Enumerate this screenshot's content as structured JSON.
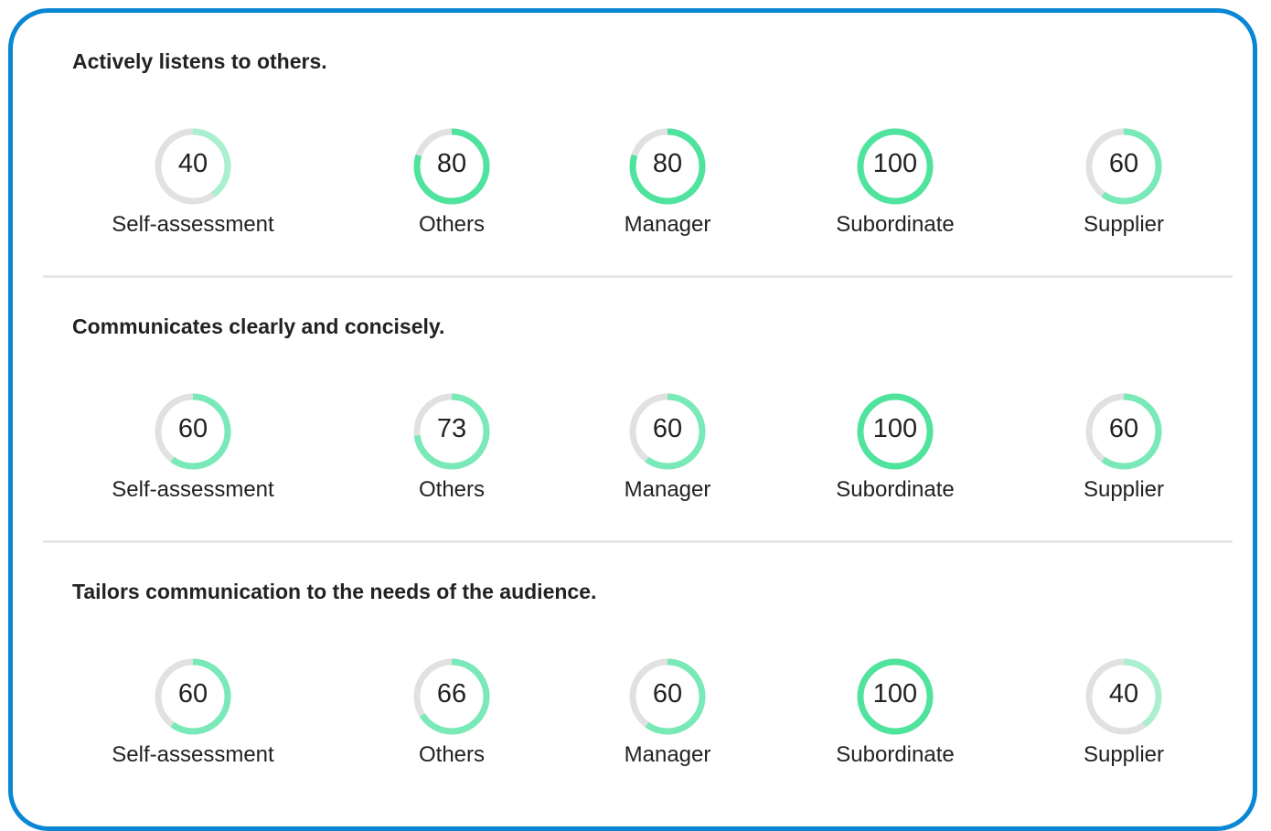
{
  "colors": {
    "border": "#0a87d4",
    "track": "#e1e1e1",
    "high": "#4fe39e",
    "mid": "#7ae9b8",
    "low": "#aaf0cf"
  },
  "sections": [
    {
      "title": "Actively listens to others.",
      "gauges": [
        {
          "label": "Self-assessment",
          "value": 40
        },
        {
          "label": "Others",
          "value": 80
        },
        {
          "label": "Manager",
          "value": 80
        },
        {
          "label": "Subordinate",
          "value": 100
        },
        {
          "label": "Supplier",
          "value": 60
        }
      ]
    },
    {
      "title": "Communicates clearly and concisely.",
      "gauges": [
        {
          "label": "Self-assessment",
          "value": 60
        },
        {
          "label": "Others",
          "value": 73
        },
        {
          "label": "Manager",
          "value": 60
        },
        {
          "label": "Subordinate",
          "value": 100
        },
        {
          "label": "Supplier",
          "value": 60
        }
      ]
    },
    {
      "title": "Tailors communication to the needs of the audience.",
      "gauges": [
        {
          "label": "Self-assessment",
          "value": 60
        },
        {
          "label": "Others",
          "value": 66
        },
        {
          "label": "Manager",
          "value": 60
        },
        {
          "label": "Subordinate",
          "value": 100
        },
        {
          "label": "Supplier",
          "value": 40
        }
      ]
    }
  ]
}
